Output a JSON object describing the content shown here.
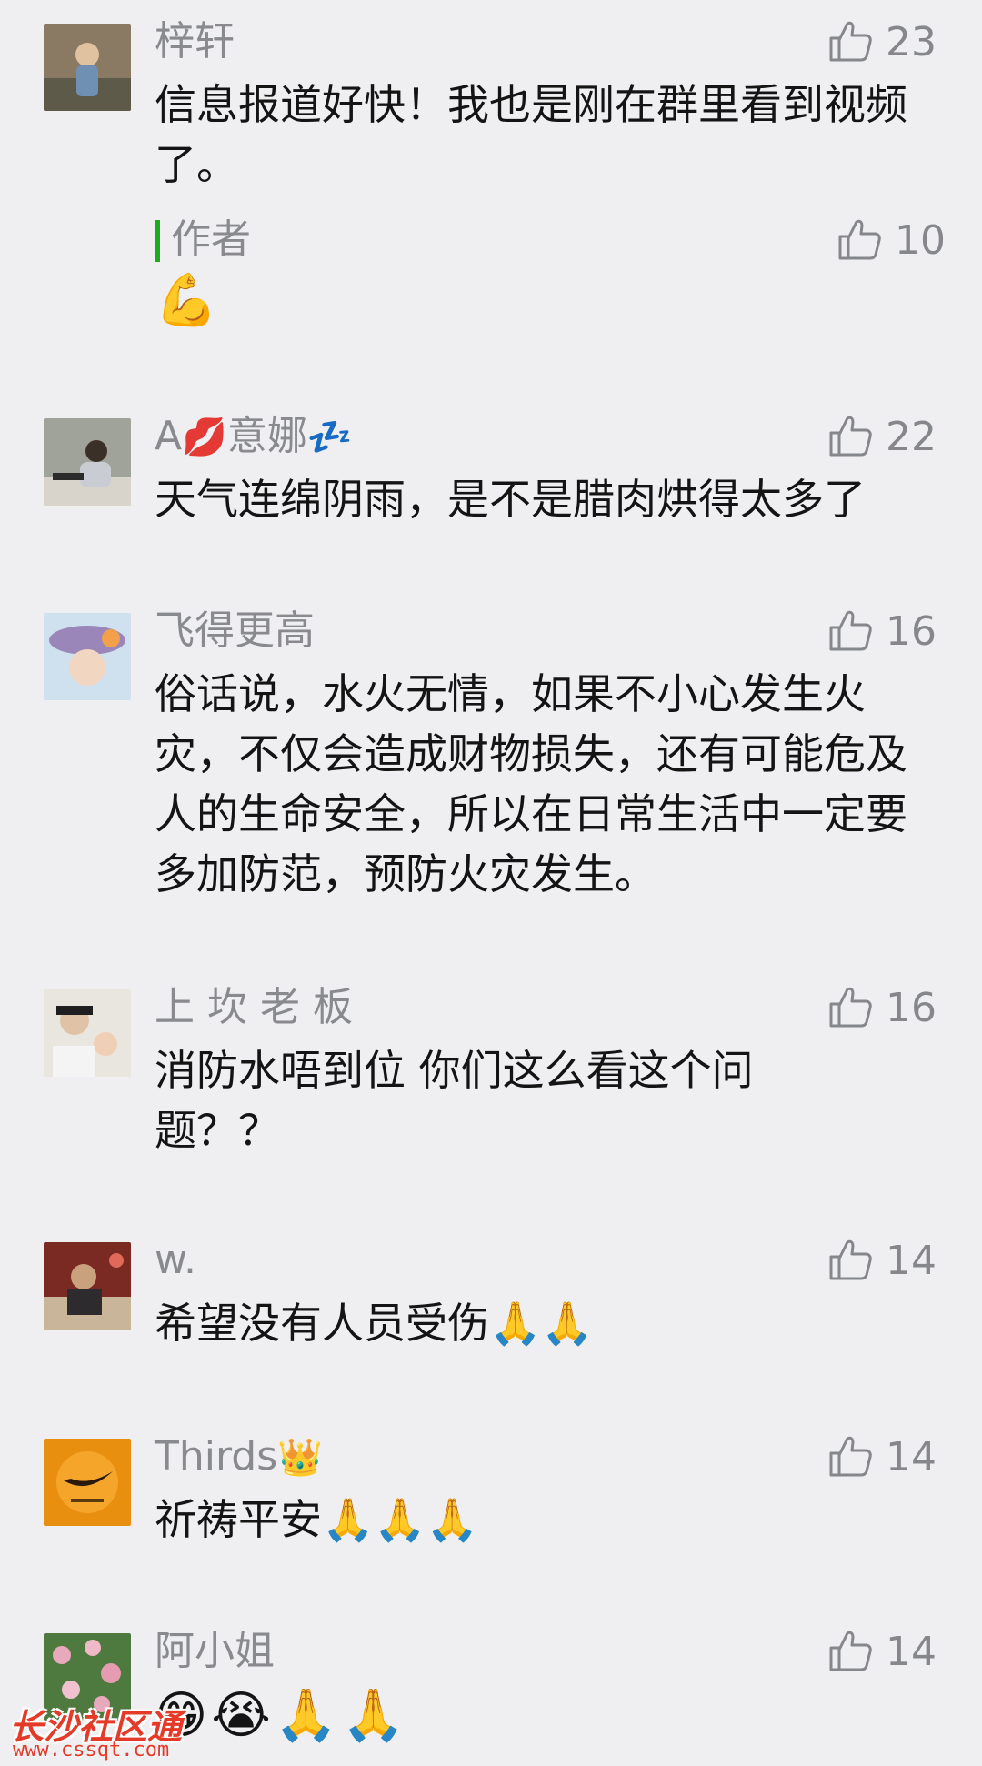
{
  "comments": [
    {
      "name": "梓轩",
      "name_deco": "",
      "likes": "23",
      "text": "信息报道好快！我也是刚在群里看到视频了。",
      "reply": {
        "label": "作者",
        "likes": "10",
        "text": "💪"
      }
    },
    {
      "name": "A",
      "name_deco": "💋",
      "name_suffix": "意娜",
      "name_deco2": "💤",
      "likes": "22",
      "text": "天气连绵阴雨，是不是腊肉烘得太多了"
    },
    {
      "name": "飞得更高",
      "likes": "16",
      "text": "俗话说，水火无情，如果不小心发生火灾，不仅会造成财物损失，还有可能危及人的生命安全，所以在日常生活中一定要多加防范，预防火灾发生。"
    },
    {
      "name": "上 坎 老 板",
      "likes": "16",
      "text": "消防水唔到位  你们这么看这个问题？？"
    },
    {
      "name": "w.",
      "likes": "14",
      "text": "希望没有人员受伤🙏🙏"
    },
    {
      "name": "Thirds",
      "name_deco": "👑",
      "likes": "14",
      "text": "祈祷平安🙏🙏🙏"
    },
    {
      "name": "阿小姐",
      "likes": "14",
      "text": "😁😭🙏🙏"
    }
  ],
  "watermark": {
    "title": "长沙社区通",
    "url": "www.cssqt.com"
  },
  "colors": {
    "accent_bar": "#1aad19",
    "watermark": "#e53a27",
    "background": "#efeff1"
  }
}
